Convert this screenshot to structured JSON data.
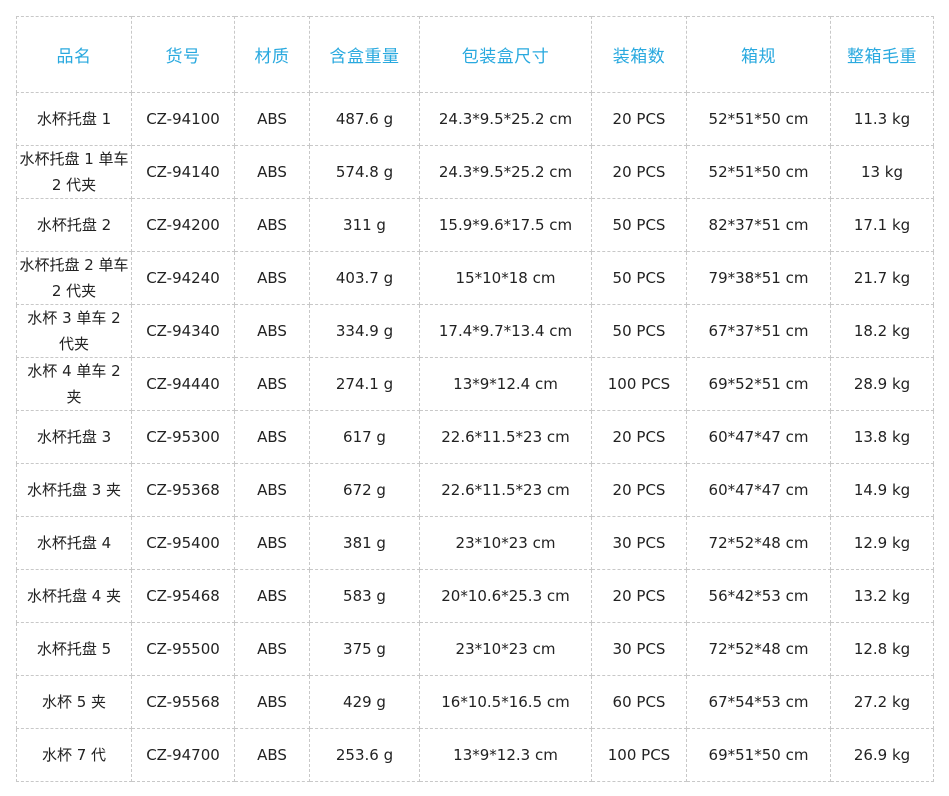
{
  "colors": {
    "header_text": "#29a9df",
    "cell_text": "#222222",
    "grid_line": "#c8c8c8"
  },
  "table": {
    "columns": [
      "品名",
      "货号",
      "材质",
      "含盒重量",
      "包装盒尺寸",
      "装箱数",
      "箱规",
      "整箱毛重"
    ],
    "rows": [
      {
        "name": "水杯托盘 1",
        "sku": "CZ-94100",
        "material": "ABS",
        "weight": "487.6 g",
        "box_size": "24.3*9.5*25.2 cm",
        "qty": "20 PCS",
        "carton": "52*51*50 cm",
        "gross": "11.3 kg"
      },
      {
        "name": "水杯托盘 1 单车 2 代夹",
        "sku": "CZ-94140",
        "material": "ABS",
        "weight": "574.8 g",
        "box_size": "24.3*9.5*25.2 cm",
        "qty": "20 PCS",
        "carton": "52*51*50 cm",
        "gross": "13 kg"
      },
      {
        "name": "水杯托盘 2",
        "sku": "CZ-94200",
        "material": "ABS",
        "weight": "311 g",
        "box_size": "15.9*9.6*17.5 cm",
        "qty": "50 PCS",
        "carton": "82*37*51 cm",
        "gross": "17.1 kg"
      },
      {
        "name": "水杯托盘 2 单车 2 代夹",
        "sku": "CZ-94240",
        "material": "ABS",
        "weight": "403.7 g",
        "box_size": "15*10*18 cm",
        "qty": "50 PCS",
        "carton": "79*38*51 cm",
        "gross": "21.7 kg"
      },
      {
        "name": "水杯 3 单车 2 代夹",
        "sku": "CZ-94340",
        "material": "ABS",
        "weight": "334.9 g",
        "box_size": "17.4*9.7*13.4 cm",
        "qty": "50 PCS",
        "carton": "67*37*51 cm",
        "gross": "18.2 kg"
      },
      {
        "name": "水杯 4 单车 2 夹",
        "sku": "CZ-94440",
        "material": "ABS",
        "weight": "274.1 g",
        "box_size": "13*9*12.4 cm",
        "qty": "100 PCS",
        "carton": "69*52*51 cm",
        "gross": "28.9 kg"
      },
      {
        "name": "水杯托盘 3",
        "sku": "CZ-95300",
        "material": "ABS",
        "weight": "617 g",
        "box_size": "22.6*11.5*23 cm",
        "qty": "20 PCS",
        "carton": "60*47*47 cm",
        "gross": "13.8 kg"
      },
      {
        "name": "水杯托盘 3 夹",
        "sku": "CZ-95368",
        "material": "ABS",
        "weight": "672 g",
        "box_size": "22.6*11.5*23 cm",
        "qty": "20 PCS",
        "carton": "60*47*47 cm",
        "gross": "14.9 kg"
      },
      {
        "name": "水杯托盘 4",
        "sku": "CZ-95400",
        "material": "ABS",
        "weight": "381 g",
        "box_size": "23*10*23 cm",
        "qty": "30 PCS",
        "carton": "72*52*48 cm",
        "gross": "12.9 kg"
      },
      {
        "name": "水杯托盘 4 夹",
        "sku": "CZ-95468",
        "material": "ABS",
        "weight": "583 g",
        "box_size": "20*10.6*25.3 cm",
        "qty": "20 PCS",
        "carton": "56*42*53 cm",
        "gross": "13.2 kg"
      },
      {
        "name": "水杯托盘 5",
        "sku": "CZ-95500",
        "material": "ABS",
        "weight": "375 g",
        "box_size": "23*10*23 cm",
        "qty": "30 PCS",
        "carton": "72*52*48 cm",
        "gross": "12.8 kg"
      },
      {
        "name": "水杯 5 夹",
        "sku": "CZ-95568",
        "material": "ABS",
        "weight": "429 g",
        "box_size": "16*10.5*16.5 cm",
        "qty": "60 PCS",
        "carton": "67*54*53 cm",
        "gross": "27.2 kg"
      },
      {
        "name": "水杯 7 代",
        "sku": "CZ-94700",
        "material": "ABS",
        "weight": "253.6 g",
        "box_size": "13*9*12.3 cm",
        "qty": "100 PCS",
        "carton": "69*51*50 cm",
        "gross": "26.9 kg"
      }
    ]
  }
}
